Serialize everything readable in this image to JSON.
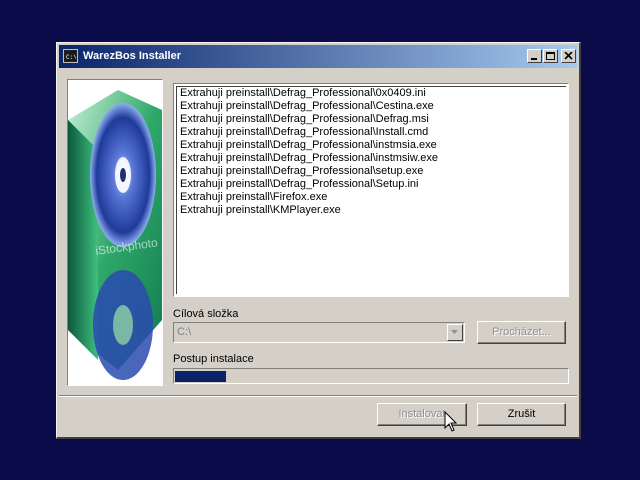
{
  "window": {
    "title": "WarezBos Installer",
    "buttons": {
      "minimize": "minimize-icon",
      "maximize": "maximize-icon",
      "close": "close-icon"
    }
  },
  "image": {
    "watermark": "iStockphoto",
    "colors": {
      "box_green": "#2fa86a",
      "box_light": "#c8f0d8",
      "disc_blue": "#3a58c8"
    }
  },
  "log": {
    "lines": [
      "Extrahuji preinstall\\Defrag_Professional\\0x0409.ini",
      "Extrahuji preinstall\\Defrag_Professional\\Cestina.exe",
      "Extrahuji preinstall\\Defrag_Professional\\Defrag.msi",
      "Extrahuji preinstall\\Defrag_Professional\\Install.cmd",
      "Extrahuji preinstall\\Defrag_Professional\\instmsia.exe",
      "Extrahuji preinstall\\Defrag_Professional\\instmsiw.exe",
      "Extrahuji preinstall\\Defrag_Professional\\setup.exe",
      "Extrahuji preinstall\\Defrag_Professional\\Setup.ini",
      "Extrahuji preinstall\\Firefox.exe",
      "Extrahuji preinstall\\KMPlayer.exe"
    ]
  },
  "target": {
    "label": "Cílová složka",
    "value": "C:\\",
    "browse_label": "Procházet..."
  },
  "progress": {
    "label": "Postup instalace",
    "fraction": 0.13,
    "color": "#0a246a"
  },
  "actions": {
    "install_label": "Instalovat",
    "cancel_label": "Zrušit"
  }
}
